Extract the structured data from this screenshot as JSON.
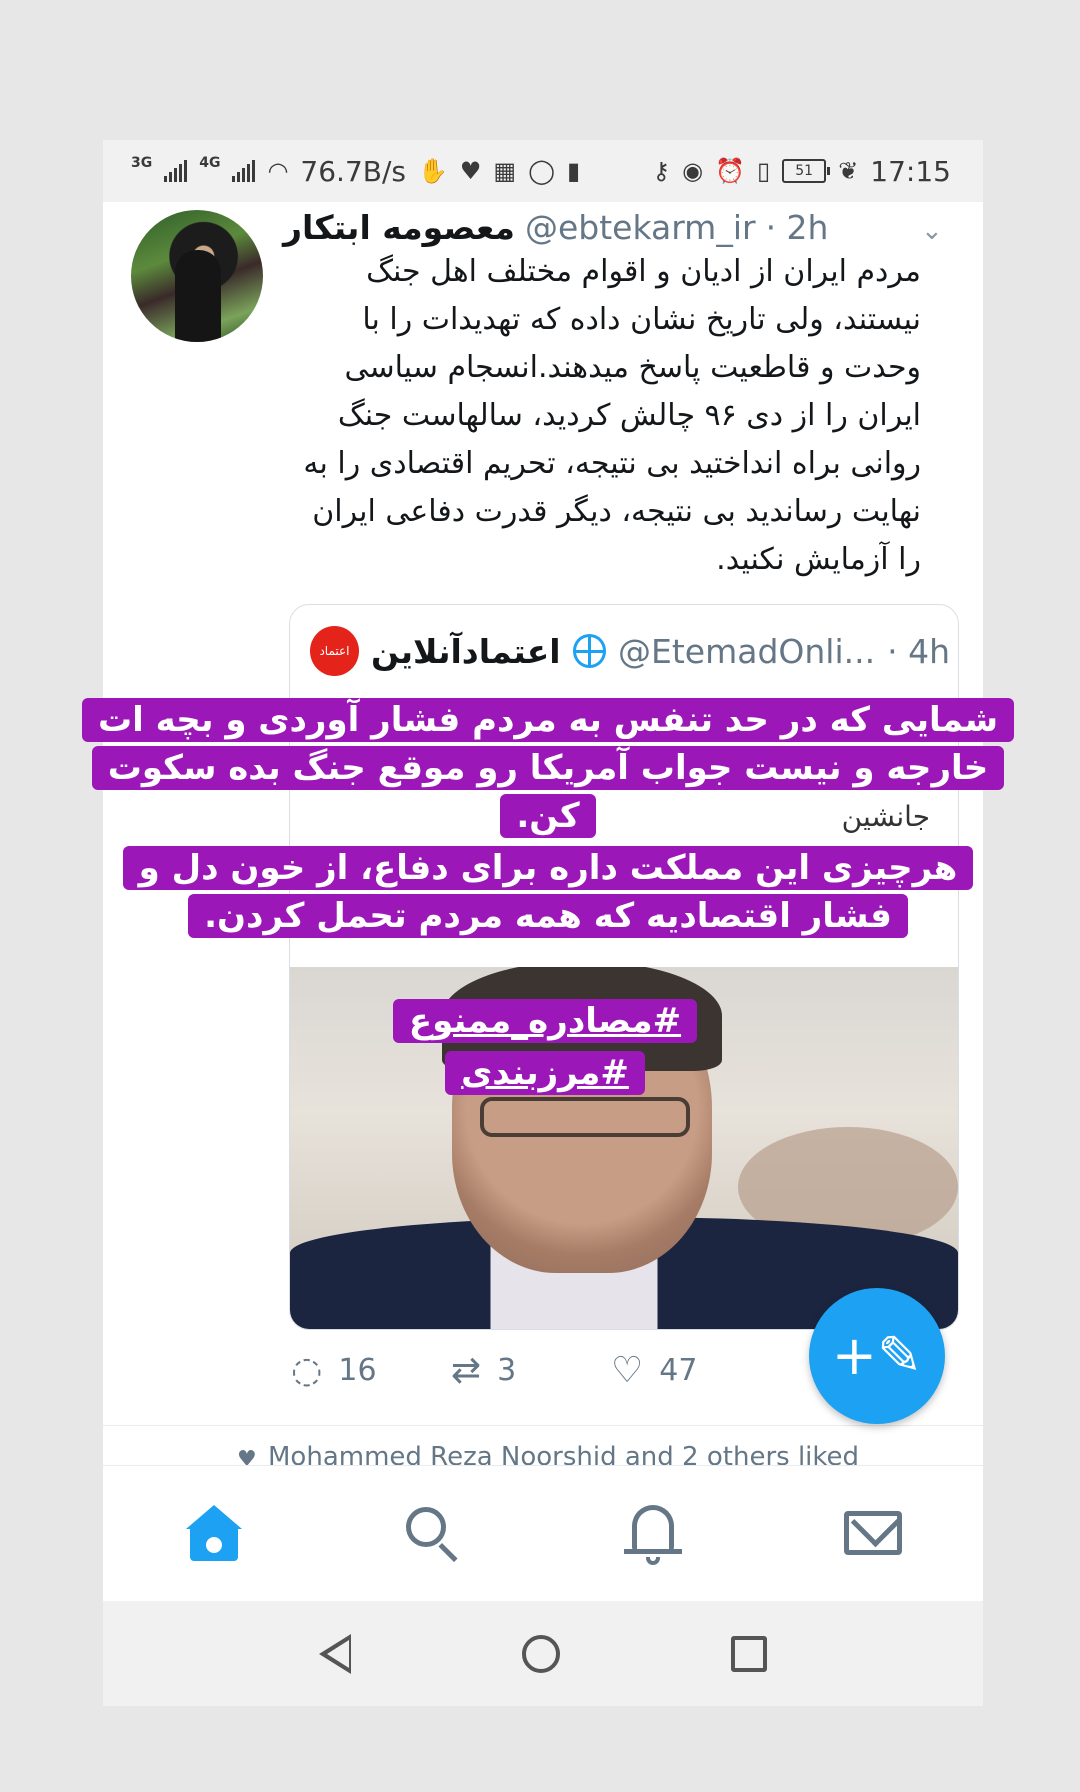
{
  "status_bar": {
    "network_1": "3G",
    "network_2": "4G",
    "speed": "76.7B/s",
    "battery": "51",
    "time": "17:15",
    "icons_left": [
      "signal-icon",
      "signal-icon",
      "wifi-icon",
      "hand-icon",
      "heart-monitor-icon",
      "calendar-icon",
      "whatsapp-icon",
      "battery-alert-icon"
    ],
    "icons_right": [
      "key-icon",
      "eye-icon",
      "alarm-icon",
      "vibrate-icon",
      "leaf-icon"
    ]
  },
  "tweet": {
    "name": "معصومه ابتکار",
    "handle": "@ebtekarm_ir",
    "time": "· 2h",
    "text": "مردم ایران از ادیان و اقوام مختلف اهل جنگ نیستند، ولی تاریخ نشان داده که تهدیدات را با وحدت و قاطعیت پاسخ میدهند.انسجام سیاسی ایران را از دی ۹۶ چالش کردید، سالهاست جنگ روانی براه انداختید بی نتیجه، تحریم اقتصادی را به نهایت رساندید بی نتیجه، دیگر قدرت دفاعی ایران را آزمایش نکنید."
  },
  "quote": {
    "name": "اعتمادآنلاین",
    "handle": "@EtemadOnli...",
    "time": "· 4h",
    "logo_text": "اعتماد",
    "text": "جانشین"
  },
  "actions": {
    "reply_count": "16",
    "retweet_count": "3",
    "like_count": "47"
  },
  "liked_by": "Mohammed Reza Noorshid and 2 others liked",
  "overlay": {
    "caption_1": "شمایی که در حد تنفس به مردم فشار آوردی و بچه ات خارجه و نیست جواب آمریکا رو موقع جنگ بده سکوت کن.",
    "caption_2": "هرچیزی این مملکت داره برای دفاع، از خون دل و فشار اقتصادیه که همه مردم تحمل کردن.",
    "hashtag_1": "#مصادره_ممنوع",
    "hashtag_2": "#مرزبندی"
  },
  "colors": {
    "accent": "#1da1f2",
    "caption_bg": "#9b17b8",
    "text": "#14171a",
    "muted": "#657786"
  }
}
